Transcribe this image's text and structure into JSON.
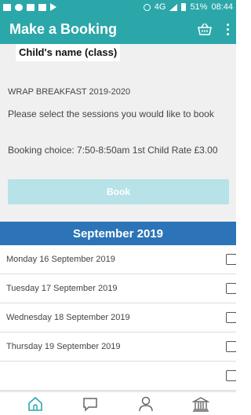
{
  "status_bar": {
    "signal": "4G",
    "battery": "51%",
    "time": "08:44"
  },
  "app_bar": {
    "title": "Make a Booking",
    "icons": [
      "basket-icon",
      "more-vert-icon"
    ]
  },
  "booking": {
    "child_name": "Child's name (class)",
    "club_name": "WRAP BREAKFAST 2019-2020",
    "instruction": "Please select the sessions you would like to book",
    "choice": "Booking choice: 7:50-8:50am 1st Child Rate £3.00",
    "book_label": "Book"
  },
  "month": {
    "title": "September 2019"
  },
  "sessions": [
    {
      "label": "Monday 16 September 2019",
      "checked": false
    },
    {
      "label": "Tuesday 17 September 2019",
      "checked": false
    },
    {
      "label": "Wednesday 18 September 2019",
      "checked": false
    },
    {
      "label": "Thursday 19 September 2019",
      "checked": false
    }
  ],
  "bottom_nav": {
    "items": [
      "home-icon",
      "chat-icon",
      "profile-icon",
      "bank-icon"
    ],
    "active_color": "#2ba7a9"
  },
  "colors": {
    "brand": "#2ba7a9",
    "month_header": "#2c74b7",
    "book_disabled": "#b7e2e8"
  }
}
